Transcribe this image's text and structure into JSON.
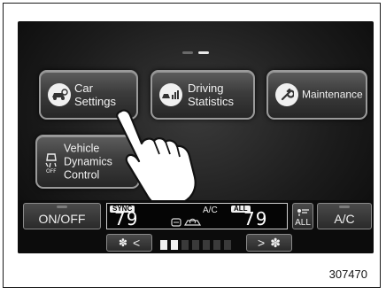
{
  "home": {
    "tiles": {
      "car_settings": "Car Settings",
      "driving_statistics": [
        "Driving",
        "Statistics"
      ],
      "maintenance": "Maintenance",
      "vehicle_dynamics": [
        "Vehicle",
        "Dynamics",
        "Control"
      ]
    },
    "page_indicator": {
      "pages": 2,
      "current": 2
    }
  },
  "climate": {
    "left_button": "ON/OFF",
    "right_button": "A/C",
    "sync_badge": "SYNC",
    "all_badge": "ALL",
    "ac_label": "A/C",
    "left_temp": "79",
    "right_temp": "79",
    "all_button": "ALL",
    "fan_down": "<",
    "fan_up": ">",
    "fan_level": {
      "current": 2,
      "max": 7
    }
  },
  "figure_id": "307470",
  "icons": {
    "car_settings": "car-gear-icon",
    "driving_statistics": "car-bars-icon",
    "maintenance": "wrench-icon",
    "vehicle_dynamics": "car-off-icon",
    "recirculation": "recirculation-icon",
    "fan": "fan-icon",
    "airflow_all": "airflow-icon",
    "hand": "pointing-hand-icon"
  }
}
